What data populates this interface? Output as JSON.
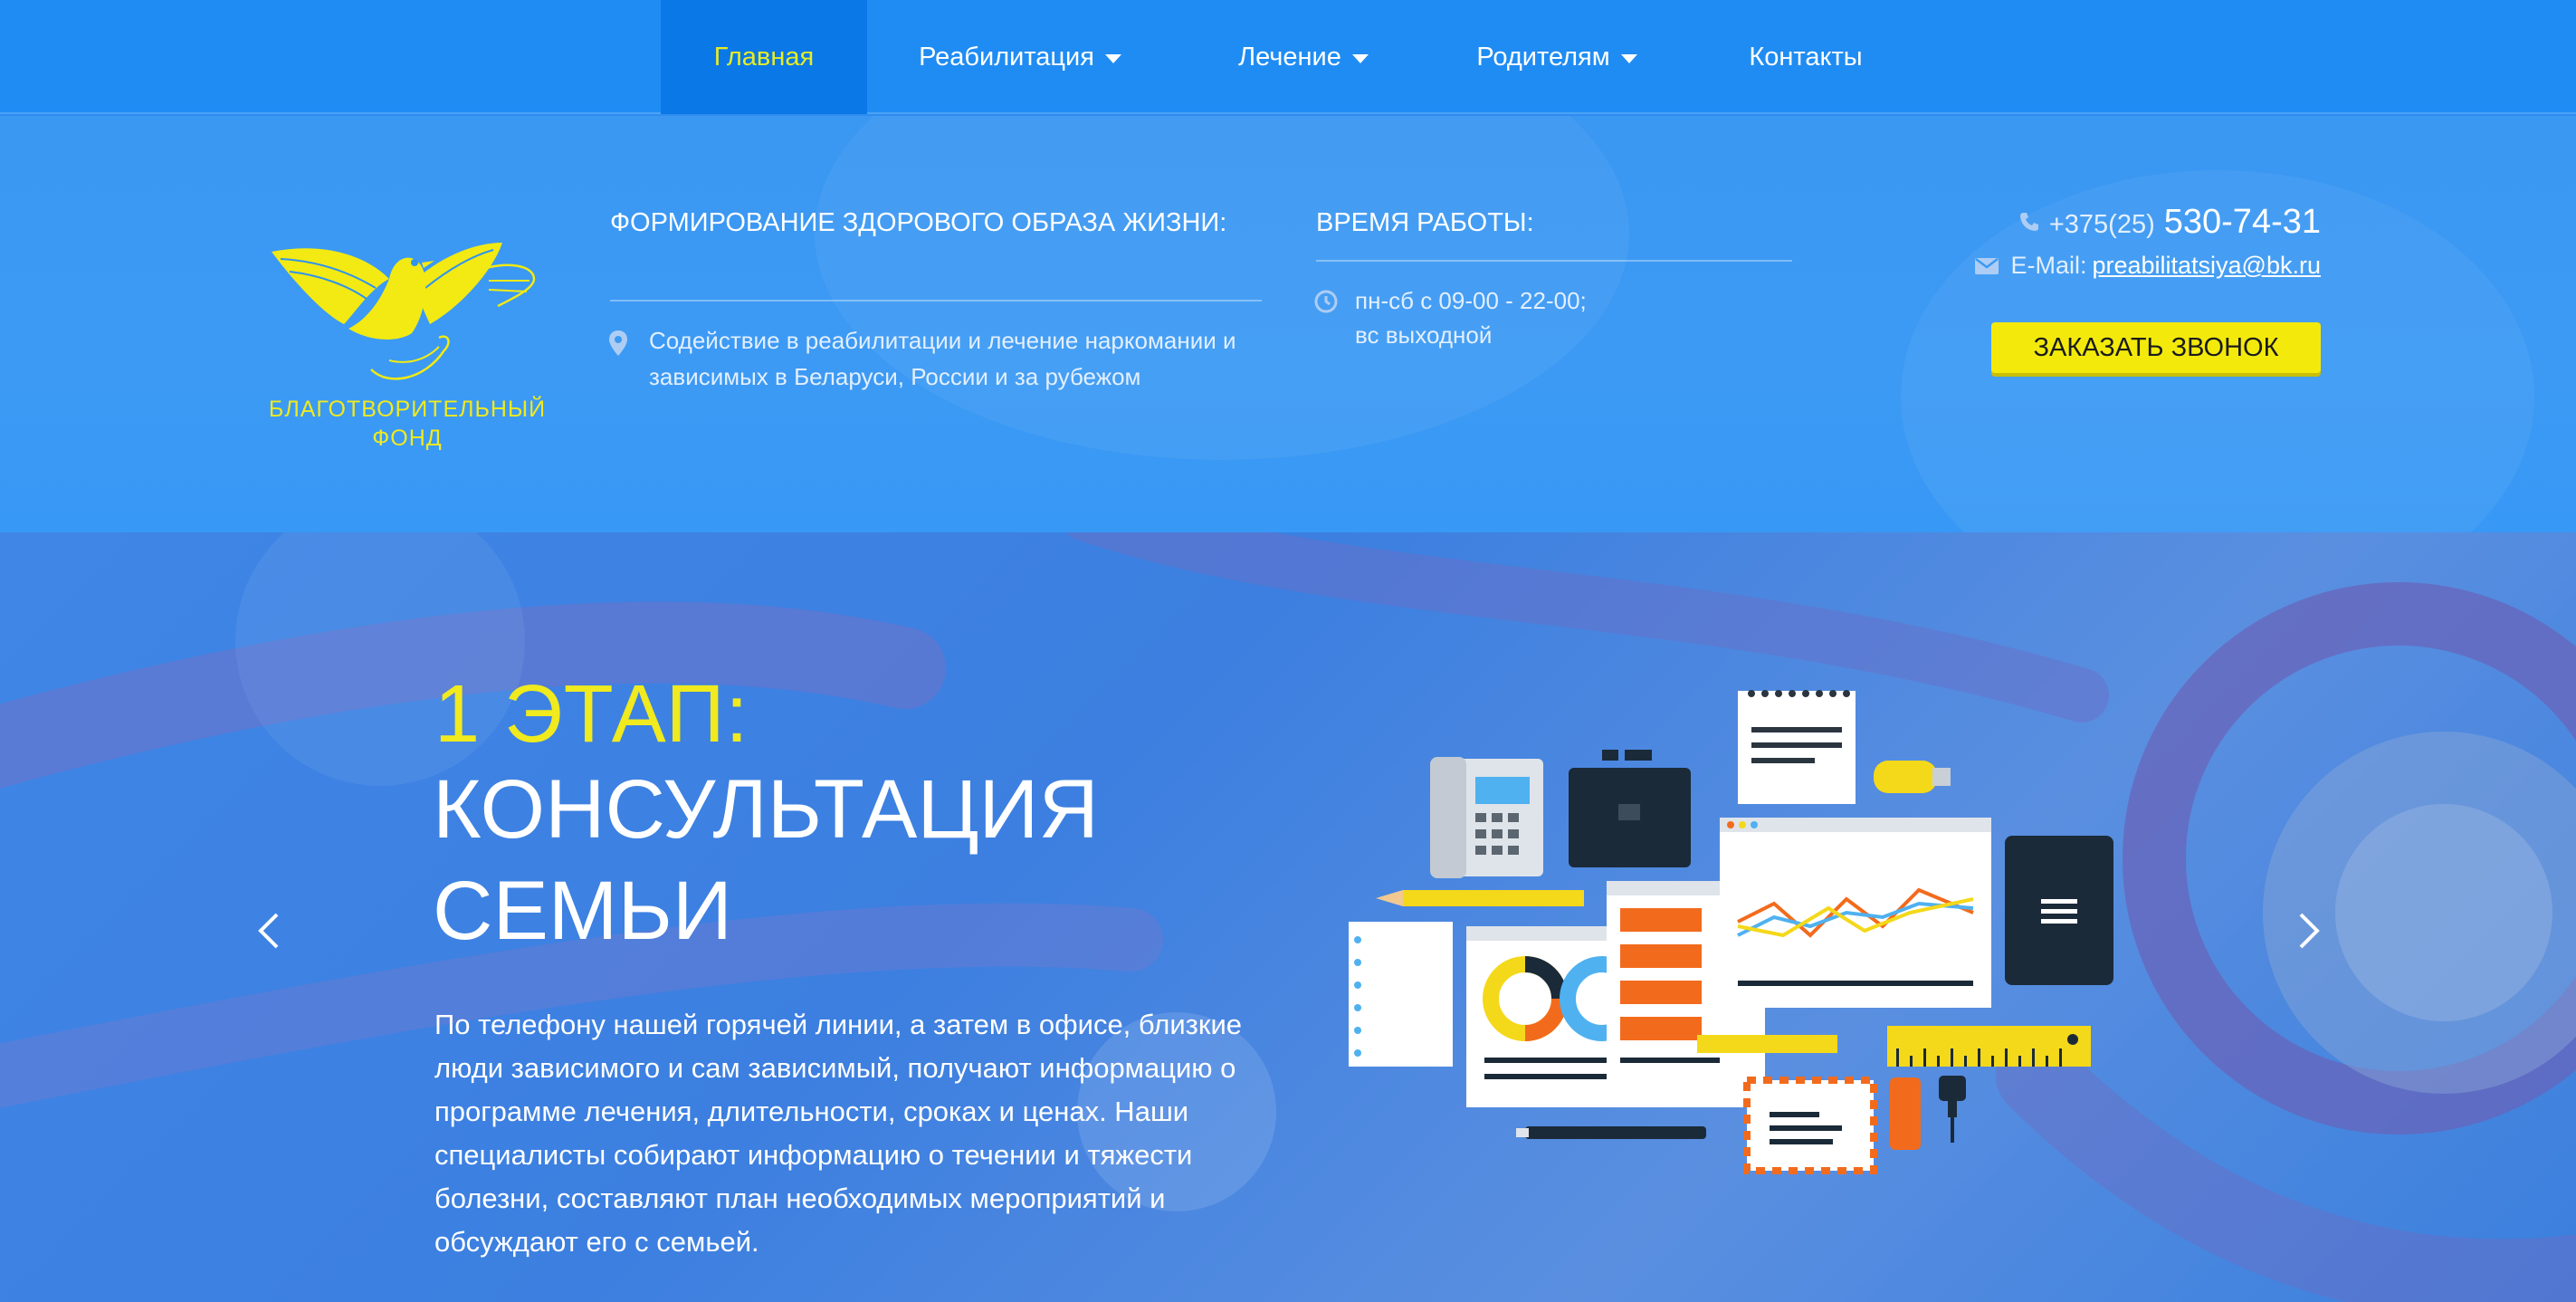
{
  "nav": {
    "items": [
      {
        "label": "Главная",
        "has_dropdown": false,
        "active": true
      },
      {
        "label": "Реабилитация",
        "has_dropdown": true,
        "active": false
      },
      {
        "label": "Лечение",
        "has_dropdown": true,
        "active": false
      },
      {
        "label": "Родителям",
        "has_dropdown": true,
        "active": false
      },
      {
        "label": "Контакты",
        "has_dropdown": false,
        "active": false
      }
    ]
  },
  "header": {
    "logo": {
      "line1": "БЛАГОТВОРИТЕЛЬНЫЙ",
      "line2": "ФОНД",
      "icon": "dove-hands-logo"
    },
    "mission": {
      "title": "ФОРМИРОВАНИЕ ЗДОРОВОГО ОБРАЗА ЖИЗНИ:",
      "icon": "map-pin-icon",
      "text": "Содействие в реабилитации и лечение наркомании и зависимых в Беларуси, России и за рубежом"
    },
    "hours": {
      "title": "ВРЕМЯ РАБОТЫ:",
      "icon": "clock-icon",
      "line1": "пн-сб с 09-00 - 22-00;",
      "line2": "вс выходной"
    },
    "contact": {
      "phone_icon": "phone-icon",
      "phone_code": "+375(25)",
      "phone_number": "530-74-31",
      "mail_icon": "envelope-icon",
      "email_label": "E-Mail:",
      "email": "preabilitatsiya@bk.ru",
      "callback_label": "ЗАКАЗАТЬ ЗВОНОК"
    }
  },
  "hero": {
    "stage": "1 ЭТАП:",
    "title_line1": "КОНСУЛЬТАЦИЯ",
    "title_line2": "СЕМЬИ",
    "text": "По телефону нашей горячей линии, а затем в офисе, близкие люди зависимого и сам зависимый, получают информацию о программе лечения, длительности, сроках и ценах. Наши специалисты собирают информацию о течении и тяжести болезни, составляют план необходимых мероприятий и обсуждают его с семьей.",
    "prev_icon": "chevron-left-icon",
    "next_icon": "chevron-right-icon"
  },
  "colors": {
    "nav_bg": "#1f8cf3",
    "nav_active_bg": "#0a78e6",
    "accent_yellow": "#f0ea1e",
    "button_yellow": "#f3ea0c",
    "header_bg": "#3c9af4"
  }
}
